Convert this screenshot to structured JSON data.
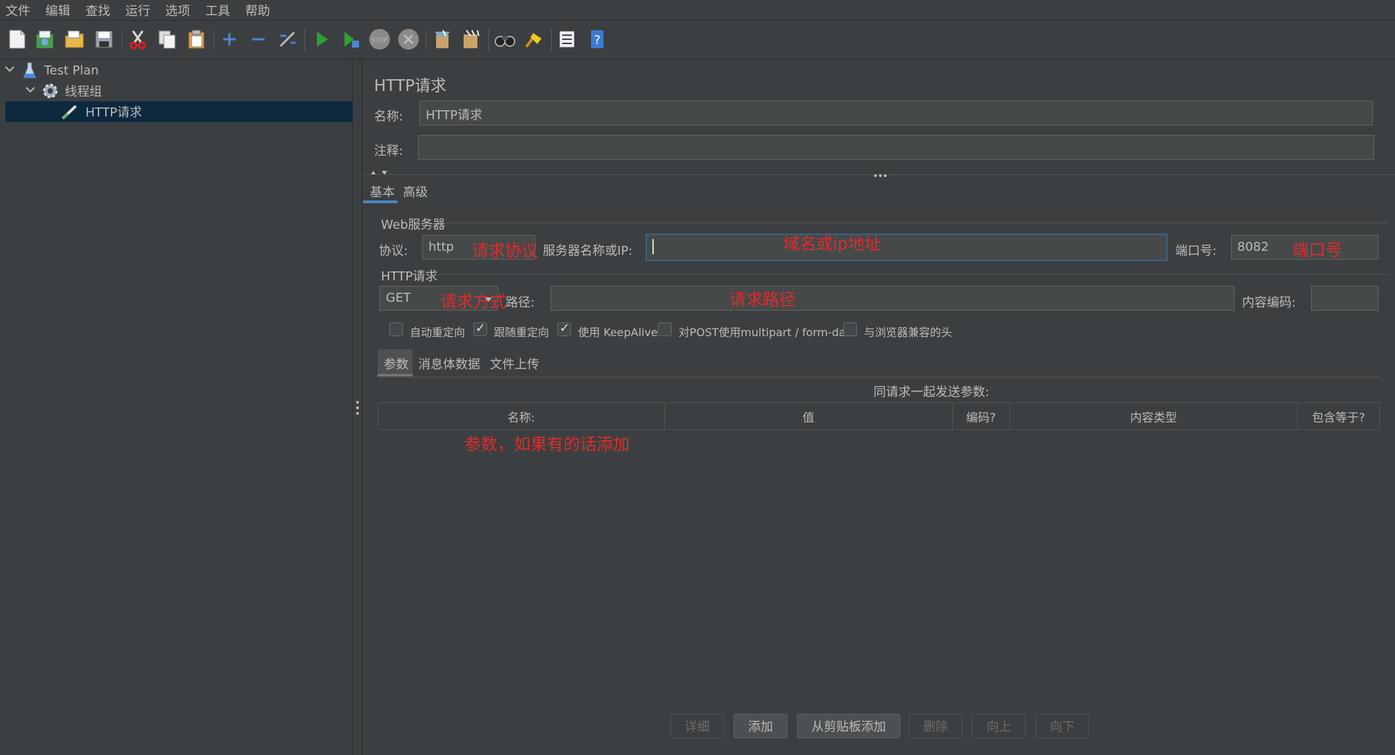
{
  "menu": [
    "文件",
    "编辑",
    "查找",
    "运行",
    "选项",
    "工具",
    "帮助"
  ],
  "toolbar_icons": [
    "new-icon",
    "templates-icon",
    "open-icon",
    "save-icon",
    "cut-icon",
    "copy-icon",
    "paste-icon",
    "expand-icon",
    "collapse-icon",
    "toggle-icon",
    "start-icon",
    "start-no-pause-icon",
    "stop-icon",
    "shutdown-icon",
    "clear-icon",
    "clear-all-icon",
    "search-icon",
    "reset-search-icon",
    "function-helper-icon",
    "help-icon"
  ],
  "tree": {
    "test_plan": "Test Plan",
    "thread_group": "线程组",
    "http_request": "HTTP请求"
  },
  "panel": {
    "title": "HTTP请求",
    "name_label": "名称:",
    "name_value": "HTTP请求",
    "comment_label": "注释:",
    "comment_value": "",
    "tabs": [
      "基本",
      "高级"
    ]
  },
  "web_server": {
    "group_label": "Web服务器",
    "protocol_label": "协议:",
    "protocol_value": "http",
    "server_label": "服务器名称或IP:",
    "server_value": "",
    "port_label": "端口号:",
    "port_value": "8082"
  },
  "http_request": {
    "group_label": "HTTP请求",
    "method_value": "GET",
    "path_label": "路径:",
    "path_value": "",
    "encoding_label": "内容编码:",
    "encoding_value": ""
  },
  "checkboxes": [
    {
      "label": "自动重定向",
      "checked": false
    },
    {
      "label": "跟随重定向",
      "checked": true
    },
    {
      "label": "使用 KeepAlive",
      "checked": true
    },
    {
      "label": "对POST使用multipart / form-data",
      "checked": false
    },
    {
      "label": "与浏览器兼容的头",
      "checked": false
    }
  ],
  "sub_tabs": [
    "参数",
    "消息体数据",
    "文件上传"
  ],
  "params": {
    "caption": "同请求一起发送参数:",
    "columns": [
      "名称:",
      "值",
      "编码?",
      "内容类型",
      "包含等于?"
    ]
  },
  "buttons": [
    {
      "label": "详细",
      "enabled": false
    },
    {
      "label": "添加",
      "enabled": true
    },
    {
      "label": "从剪贴板添加",
      "enabled": true
    },
    {
      "label": "删除",
      "enabled": false
    },
    {
      "label": "向上",
      "enabled": false
    },
    {
      "label": "向下",
      "enabled": false
    }
  ],
  "annotations": {
    "protocol": "请求协议",
    "server": "域名或ip地址",
    "port": "端口号",
    "method": "请求方式",
    "path": "请求路径",
    "params": "参数，如果有的话添加"
  },
  "colors": {
    "background": "#3c3f41",
    "field": "#45494a",
    "selection": "#0d293e",
    "accent": "#4a88c7",
    "annotation": "#e22b2b"
  }
}
